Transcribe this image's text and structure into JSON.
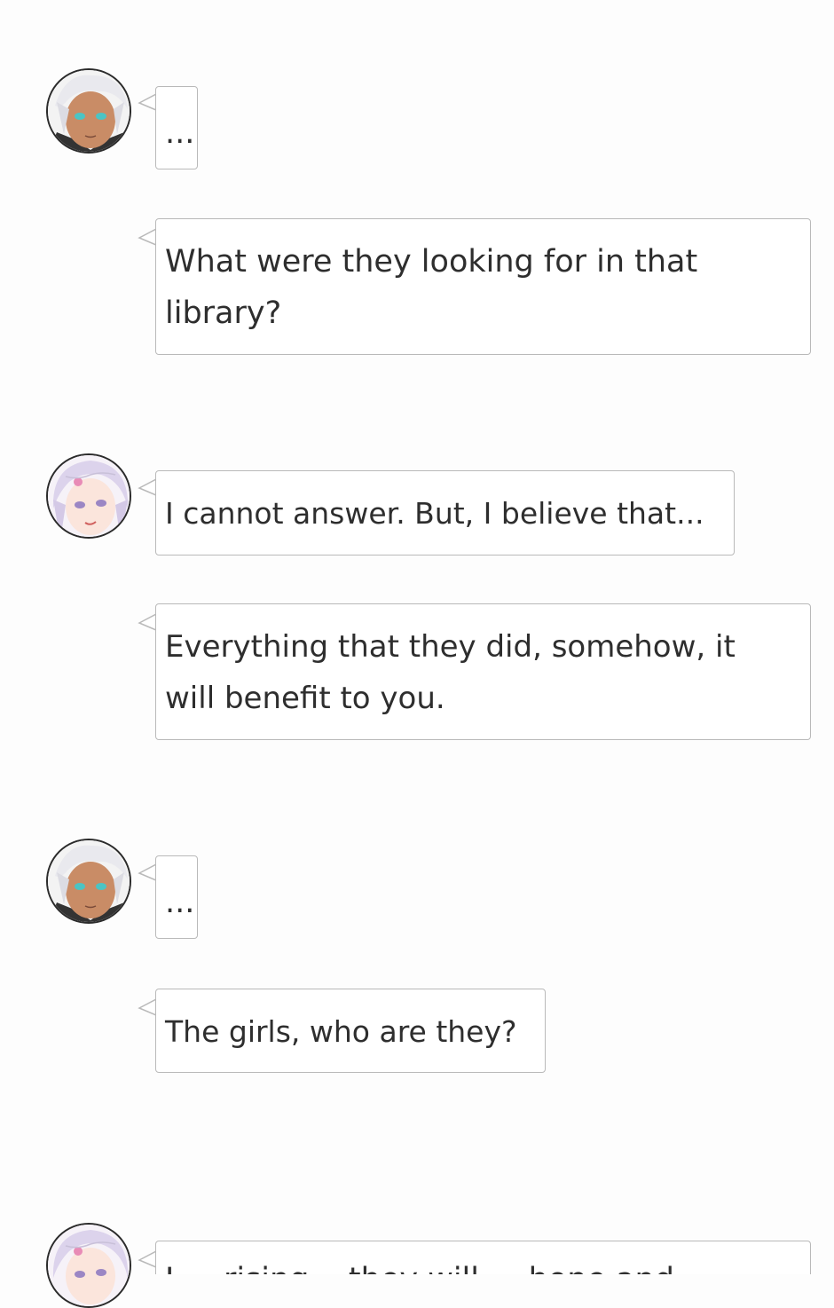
{
  "messages": [
    {
      "speaker": "silver-haired-boy",
      "text": "..."
    },
    {
      "speaker": "silver-haired-boy",
      "text": "What were they looking for in that library?"
    },
    {
      "speaker": "lavender-haired-girl",
      "text": "I cannot answer. But, I believe that..."
    },
    {
      "speaker": "lavender-haired-girl",
      "text": "Everything that they did, somehow, it will benefit to you."
    },
    {
      "speaker": "silver-haired-boy",
      "text": "..."
    },
    {
      "speaker": "silver-haired-boy",
      "text": "The girls, who are they?"
    },
    {
      "speaker": "lavender-haired-girl",
      "text": "I ... rising... they will ... hope and..."
    }
  ],
  "colors": {
    "bubble_border": "#b9b9b9",
    "bubble_bg": "#ffffff",
    "text": "#2e2e2e",
    "page_bg": "#fdfdfd"
  }
}
